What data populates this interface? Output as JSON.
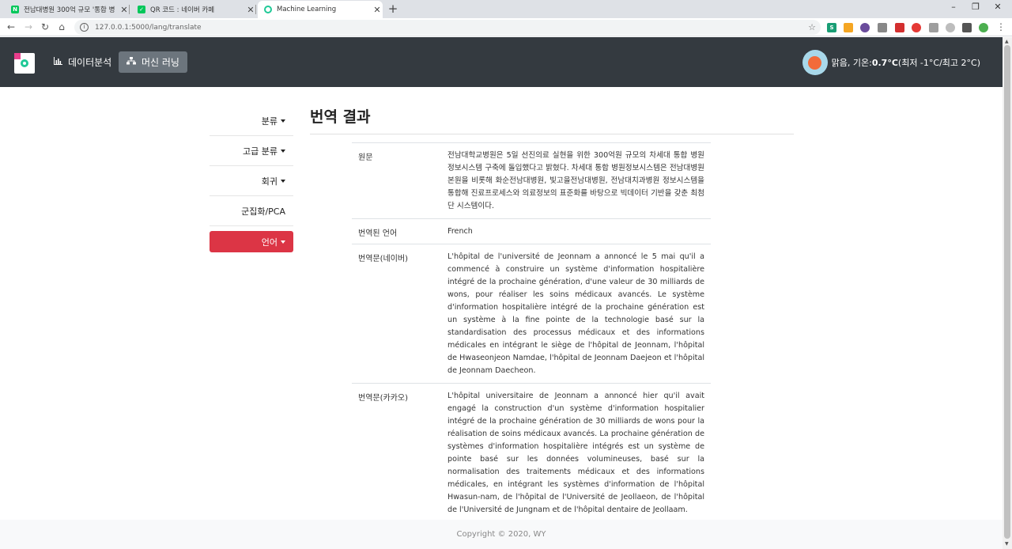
{
  "browser": {
    "tabs": [
      {
        "title": "전남대병원 300억 규모 '통합 병",
        "favicon_color": "#03c75a",
        "favicon_letter": "N"
      },
      {
        "title": "QR 코드 : 네이버 카페",
        "favicon_color": "#03c75a",
        "favicon_letter": "✓"
      },
      {
        "title": "Machine Learning",
        "favicon_color": "#20c997",
        "favicon_letter": ""
      }
    ],
    "url": "127.0.0.1:5000/lang/translate"
  },
  "navbar": {
    "items": [
      {
        "label": "데이터분석",
        "icon": "bar-chart-icon"
      },
      {
        "label": "머신 러닝",
        "icon": "sitemap-icon"
      }
    ],
    "weather": {
      "condition": "맑음, 기온: ",
      "temp": "0.7°C",
      "range": " (최저 -1°C/최고 2°C)"
    }
  },
  "sidebar": {
    "items": [
      {
        "label": "분류"
      },
      {
        "label": "고급 분류"
      },
      {
        "label": "회귀"
      },
      {
        "label": "군집화/PCA"
      },
      {
        "label": "언어"
      }
    ]
  },
  "main": {
    "title": "번역 결과",
    "rows": [
      {
        "key": "원문",
        "value": "전남대학교병원은 5일 선진의료 실현을 위한 300억원 규모의 차세대 통합 병원정보시스템 구축에 돌입했다고 밝혔다. 차세대 통합 병원정보시스템은 전남대병원 본원을 비롯해 화순전남대병원, 빛고을전남대병원, 전남대치과병원 정보시스템을 통합해 진료프로세스와 의료정보의 표준화를 바탕으로 빅데이터 기반을 갖춘 최첨단 시스템이다."
      },
      {
        "key": "번역된 언어",
        "value": "French"
      },
      {
        "key": "번역문(네이버)",
        "value": "L'hôpital de l'université de Jeonnam a annoncé le 5 mai qu'il a commencé à construire un système d'information hospitalière intégré de la prochaine génération, d'une valeur de 30 milliards de wons, pour réaliser les soins médicaux avancés. Le système d'information hospitalière intégré de la prochaine génération est un système à la fine pointe de la technologie basé sur la standardisation des processus médicaux et des informations médicales en intégrant le siège de l'hôpital de Jeonnam, l'hôpital de Hwaseonjeon Namdae, l'hôpital de Jeonnam Daejeon et l'hôpital de Jeonnam Daecheon."
      },
      {
        "key": "번역문(카카오)",
        "value": "L'hôpital universitaire de Jeonnam a annoncé hier qu'il avait engagé la construction d'un système d'information hospitalier intégré de la prochaine génération de 30 milliards de wons pour la réalisation de soins médicaux avancés. La prochaine génération de systèmes d'information hospitalière intégrés est un système de pointe basé sur les données volumineuses, basé sur la normalisation des traitements médicaux et des informations médicales, en intégrant les systèmes d'information de l'hôpital Hwasun-nam, de l'hôpital de l'Université de Jeollaeon, de l'hôpital de l'Université de Jungnam et de l'hôpital dentaire de Jeollaam."
      }
    ]
  },
  "footer": {
    "text": "Copyright © 2020, WY"
  }
}
